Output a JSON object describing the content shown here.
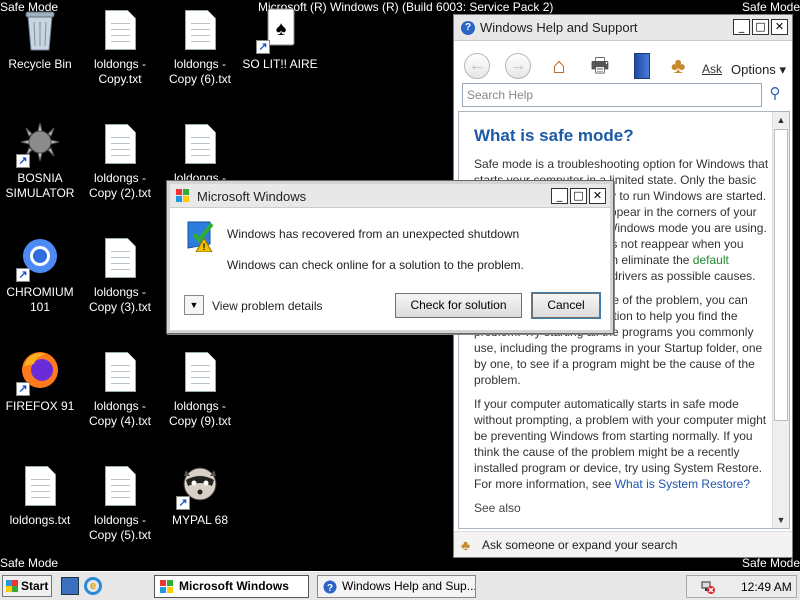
{
  "desktop": {
    "safe_mode_text": "Safe Mode",
    "build_text": "Microsoft (R) Windows (R) (Build 6003: Service Pack 2)",
    "icons": [
      {
        "label": "Recycle Bin"
      },
      {
        "label": "loldongs - Copy.txt"
      },
      {
        "label": "loldongs - Copy (6).txt"
      },
      {
        "label": "SO LIT!! AIRE"
      },
      {
        "label": "BOSNIA SIMULATOR"
      },
      {
        "label": "loldongs - Copy (2).txt"
      },
      {
        "label": "loldongs -"
      },
      {
        "label": "CHROMIUM 101"
      },
      {
        "label": "loldongs - Copy (3).txt"
      },
      {
        "label": "FIREFOX 91"
      },
      {
        "label": "loldongs - Copy (4).txt"
      },
      {
        "label": "loldongs - Copy (9).txt"
      },
      {
        "label": "loldongs.txt"
      },
      {
        "label": "loldongs - Copy (5).txt"
      },
      {
        "label": "MYPAL 68"
      }
    ]
  },
  "help_window": {
    "title": "Windows Help and Support",
    "ask_label": "Ask",
    "options_label": "Options",
    "search_placeholder": "Search Help",
    "heading": "What is safe mode?",
    "p1": "Safe mode is a troubleshooting option for Windows that starts your computer in a limited state. Only the basic files and drivers necessary to run Windows are started. The words \"Safe Mode\" appear in the corners of your monitor to identify which Windows mode you are using. If an existing problem does not reappear when you start in safe mode, you can eliminate the",
    "p1_link": "default settings",
    "p1_end": "and basic device drivers as possible causes.",
    "p2": "If you don't know the cause of the problem, you can use the process of elimination to help you find the problem. Try starting all the programs you commonly use, including the programs in your Startup folder, one by one, to see if a program might be the cause of the problem.",
    "p3": "If your computer automatically starts in safe mode without prompting, a problem with your computer might be preventing Windows from starting normally. If you think the cause of the problem might be a recently installed program or device, try using System Restore. For more information, see",
    "p3_link": "What is System Restore?",
    "more": "See also",
    "footer": "Ask someone or expand your search"
  },
  "dialog": {
    "title": "Microsoft Windows",
    "message1": "Windows has recovered from an unexpected shutdown",
    "message2": "Windows can check online for a solution to the problem.",
    "details_label": "View problem details",
    "check_button": "Check for solution",
    "cancel_button": "Cancel"
  },
  "taskbar": {
    "start_label": "Start",
    "apps": [
      {
        "label": "Microsoft Windows"
      },
      {
        "label": "Windows Help and Sup..."
      }
    ],
    "clock": "12:49 AM"
  },
  "colors": {
    "desktop_bg": "#000000",
    "help_heading": "#1b5aa8",
    "link": "#1f55ad",
    "link_green": "#1f8a2e"
  }
}
